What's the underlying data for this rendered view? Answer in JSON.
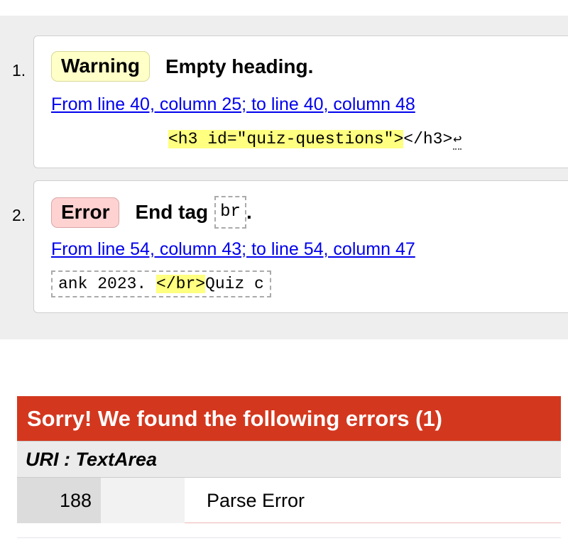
{
  "html_validator": {
    "messages": [
      {
        "number": "1.",
        "type": "Warning",
        "message": "Empty heading.",
        "location": "From line 40, column 25; to line 40, column 48",
        "extract_highlight": "<h3 id=\"quiz-questions\">",
        "extract_after": "</h3>",
        "extract_return": "↩"
      },
      {
        "number": "2.",
        "type": "Error",
        "message_prefix": "End tag",
        "message_code": "br",
        "message_suffix": ".",
        "location": "From line 54, column 43; to line 54, column 47",
        "extract_before": "ank 2023. ",
        "extract_highlight": "</br>",
        "extract_after": "Quiz c"
      }
    ]
  },
  "css_validator": {
    "header": "Sorry! We found the following errors (1)",
    "uri_label": "URI : TextArea",
    "errors": [
      {
        "line": "188",
        "context": "",
        "message": "Parse Error"
      }
    ]
  },
  "colors": {
    "panel_bg": "#eeeeee",
    "warning_badge": "#ffffc8",
    "error_badge": "#ffd2d2",
    "highlight": "#ffff80",
    "link": "#0000ee",
    "errors_header_bg": "#d3381f"
  }
}
